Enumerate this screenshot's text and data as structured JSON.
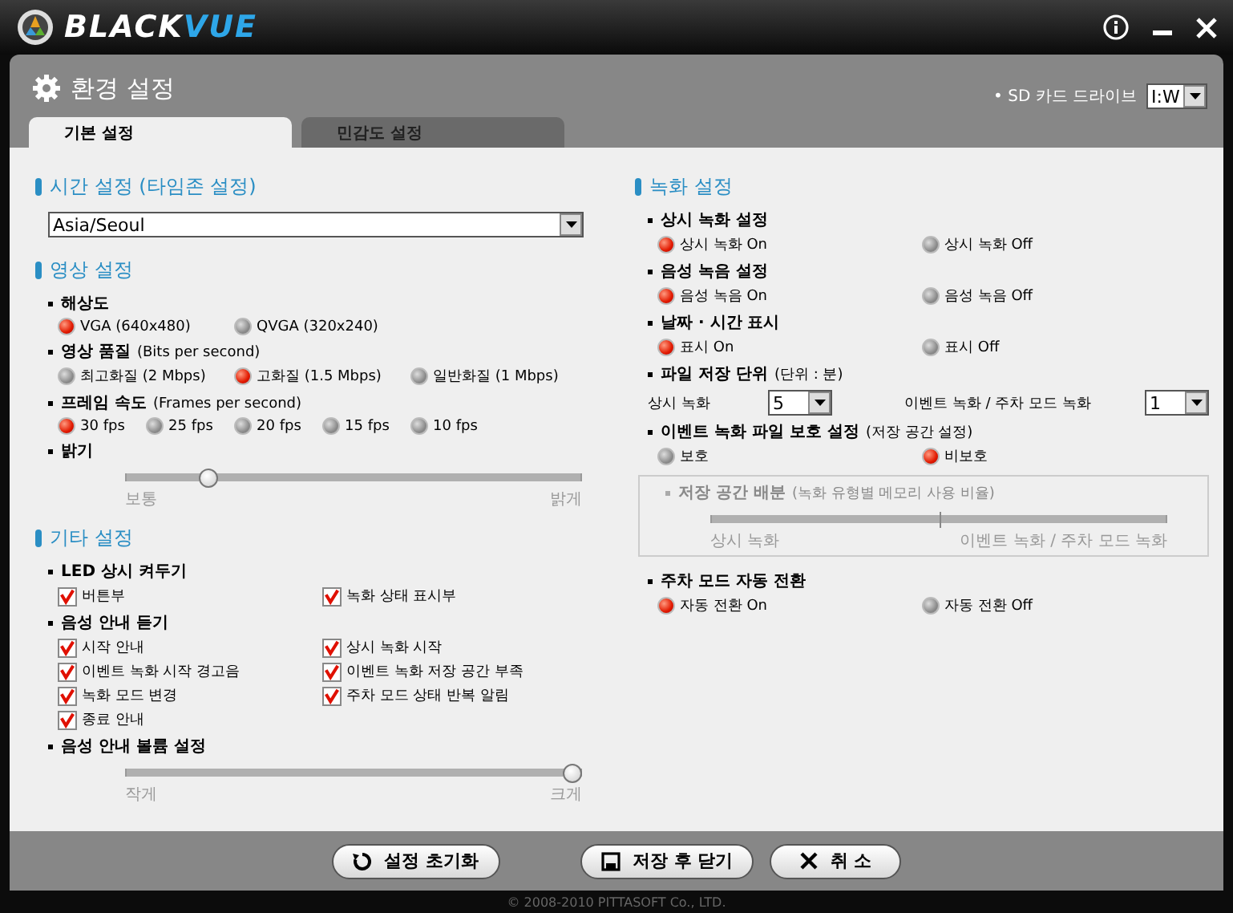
{
  "app": {
    "logo_first": "BLACK",
    "logo_second": "VUE"
  },
  "header": {
    "title": "환경 설정",
    "sd_label": "• SD 카드 드라이브",
    "sd_drive": "I:W"
  },
  "tabs": [
    {
      "label": "기본 설정",
      "selected": true
    },
    {
      "label": "민감도 설정",
      "selected": false
    }
  ],
  "left": [
    {
      "title": "시간 설정 (타임존 설정)",
      "items": [
        {
          "kind": "select",
          "value": "Asia/Seoul"
        }
      ]
    },
    {
      "title": "영상 설정",
      "items": [
        {
          "kind": "radio",
          "label": "해상도",
          "options": [
            {
              "label": "VGA (640x480)",
              "selected": true
            },
            {
              "label": "QVGA (320x240)",
              "selected": false
            }
          ]
        },
        {
          "kind": "radio",
          "label": "영상 품질",
          "note": "(Bits per second)",
          "options": [
            {
              "label": "최고화질 (2 Mbps)",
              "selected": false
            },
            {
              "label": "고화질 (1.5 Mbps)",
              "selected": true
            },
            {
              "label": "일반화질 (1 Mbps)",
              "selected": false
            }
          ]
        },
        {
          "kind": "radio",
          "label": "프레임 속도",
          "note": "(Frames per second)",
          "options": [
            {
              "label": "30 fps",
              "selected": true
            },
            {
              "label": "25 fps",
              "selected": false
            },
            {
              "label": "20 fps",
              "selected": false
            },
            {
              "label": "15 fps",
              "selected": false
            },
            {
              "label": "10 fps",
              "selected": false
            }
          ]
        },
        {
          "kind": "slider",
          "label": "밝기",
          "level": 0.17,
          "min_label": "보통",
          "max_label": "밝게"
        }
      ]
    },
    {
      "title": "기타 설정",
      "items": [
        {
          "kind": "checks",
          "label": "LED 상시 켜두기",
          "options": [
            {
              "label": "버튼부",
              "checked": true
            },
            {
              "label": "녹화 상태 표시부",
              "checked": true
            }
          ]
        },
        {
          "kind": "checks",
          "label": "음성 안내 듣기",
          "options": [
            {
              "label": "시작 안내",
              "checked": true
            },
            {
              "label": "상시 녹화 시작",
              "checked": true
            },
            {
              "label": "이벤트 녹화 시작 경고음",
              "checked": true
            },
            {
              "label": "이벤트 녹화 저장 공간 부족",
              "checked": true
            },
            {
              "label": "녹화 모드 변경",
              "checked": true
            },
            {
              "label": "주차 모드 상태 반복 알림",
              "checked": true
            },
            {
              "label": "종료 안내",
              "checked": true
            }
          ]
        },
        {
          "kind": "slider",
          "label": "음성 안내 볼륨 설정",
          "level": 1,
          "min_label": "작게",
          "max_label": "크게"
        }
      ]
    }
  ],
  "right": [
    {
      "title": "녹화 설정",
      "items": [
        {
          "kind": "radio",
          "label": "상시 녹화 설정",
          "options": [
            {
              "label": "상시 녹화 On",
              "selected": true
            },
            {
              "label": "상시 녹화 Off",
              "selected": false
            }
          ]
        },
        {
          "kind": "radio",
          "label": "음성 녹음 설정",
          "options": [
            {
              "label": "음성 녹음 On",
              "selected": true
            },
            {
              "label": "음성 녹음 Off",
              "selected": false
            }
          ]
        },
        {
          "kind": "radio",
          "label": "날짜 · 시간 표시",
          "options": [
            {
              "label": "표시 On",
              "selected": true
            },
            {
              "label": "표시 Off",
              "selected": false
            }
          ]
        },
        {
          "kind": "units",
          "label": "파일 저장 단위",
          "note": "(단위 : 분)",
          "fields": [
            {
              "label": "상시 녹화",
              "value": "5"
            },
            {
              "label": "이벤트 녹화 / 주차 모드 녹화",
              "value": "1"
            }
          ]
        },
        {
          "kind": "radio",
          "label": "이벤트 녹화 파일 보호 설정",
          "note": "(저장 공간 설정)",
          "options": [
            {
              "label": "보호",
              "selected": false
            },
            {
              "label": "비보호",
              "selected": true
            }
          ]
        },
        {
          "kind": "ratio",
          "disabled": true,
          "label": "저장 공간 배분",
          "note": "(녹화 유형별 메모리 사용 비율)",
          "level": 0.5,
          "min_label": "상시 녹화",
          "max_label": "이벤트 녹화 / 주차 모드 녹화"
        },
        {
          "kind": "radio",
          "label": "주차 모드 자동 전환",
          "options": [
            {
              "label": "자동 전환 On",
              "selected": true
            },
            {
              "label": "자동 전환 Off",
              "selected": false
            }
          ]
        }
      ]
    }
  ],
  "buttons": [
    {
      "kind": "reset",
      "label": "설정 초기화"
    },
    {
      "kind": "save",
      "label": "저장 후 닫기"
    },
    {
      "kind": "cancel",
      "label": "취 소"
    }
  ],
  "footer": "© 2008-2010 PITTASOFT Co., LTD."
}
